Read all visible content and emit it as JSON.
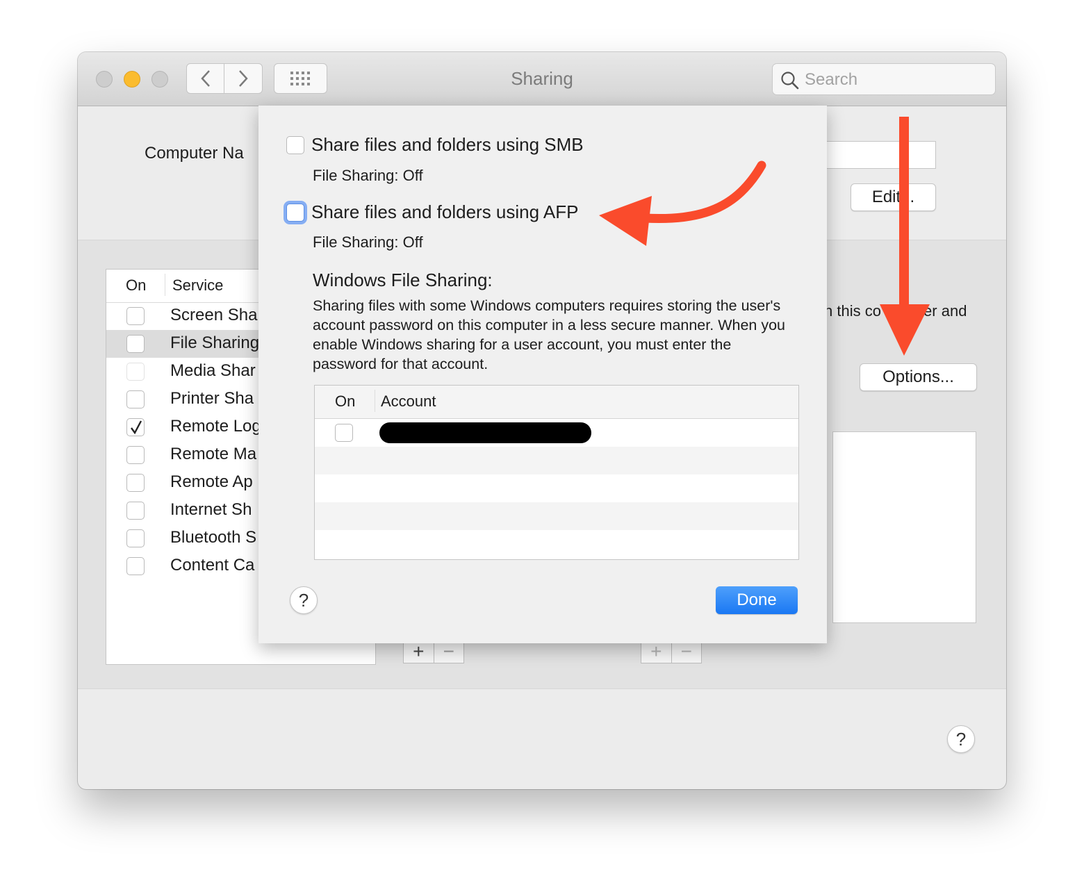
{
  "window": {
    "title": "Sharing",
    "search_placeholder": "Search"
  },
  "main": {
    "computer_name_label": "Computer Na",
    "edit_button": "Edit...",
    "description_fragment": "n this co          er and",
    "options_button": "Options..."
  },
  "services": {
    "header_on": "On",
    "header_service": "Service",
    "rows": [
      {
        "name": "Screen Sha",
        "checked": false
      },
      {
        "name": "File Sharing",
        "checked": false,
        "selected": true
      },
      {
        "name": "Media Shar",
        "checked": false,
        "dim": true
      },
      {
        "name": "Printer Sha",
        "checked": false
      },
      {
        "name": "Remote Log",
        "checked": true
      },
      {
        "name": "Remote Ma",
        "checked": false
      },
      {
        "name": "Remote Ap",
        "checked": false
      },
      {
        "name": "Internet Sh",
        "checked": false
      },
      {
        "name": "Bluetooth S",
        "checked": false
      },
      {
        "name": "Content Ca",
        "checked": false
      }
    ]
  },
  "controls": {
    "add_symbol": "+",
    "remove_symbol": "−",
    "help_symbol": "?"
  },
  "sheet": {
    "smb_label": "Share files and folders using SMB",
    "smb_status": "File Sharing: Off",
    "afp_label": "Share files and folders using AFP",
    "afp_status": "File Sharing: Off",
    "wfs_title": "Windows File Sharing:",
    "wfs_description": "Sharing files with some Windows computers requires storing the user's account password on this computer in a less secure manner. When you enable Windows sharing for a user account, you must enter the password for that account.",
    "accounts_header_on": "On",
    "accounts_header_account": "Account",
    "done_button": "Done"
  },
  "colors": {
    "annotation_arrow": "#fa4b2c",
    "done_button": "#1a78f3",
    "focus_ring": "#86aef3",
    "traffic_light_minimize": "#fbbc2e"
  },
  "icons": {
    "back": "chevron-left-icon",
    "forward": "chevron-right-icon",
    "grid": "grid-icon",
    "search": "magnifier-icon",
    "check": "checkmark-icon",
    "help": "question-mark-icon",
    "annotation": "red-arrow-icon"
  }
}
